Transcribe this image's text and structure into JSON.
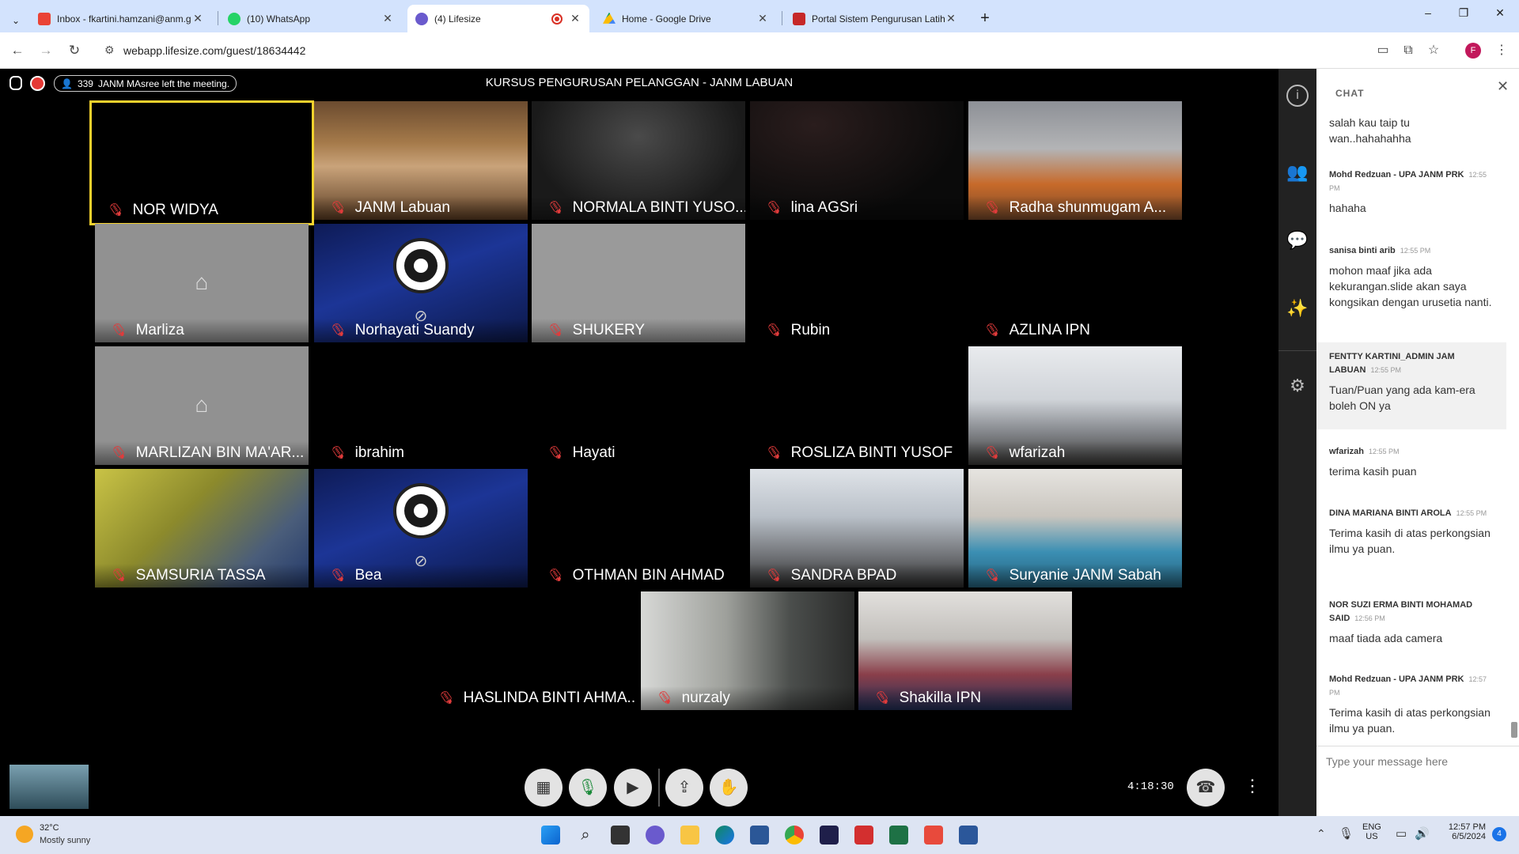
{
  "browser": {
    "tabs": [
      {
        "title": "Inbox - fkartini.hamzani@anm.g",
        "fav": "#ea4335",
        "icon": "gmail-icon"
      },
      {
        "title": "(10) WhatsApp",
        "fav": "#25d366",
        "icon": "whatsapp-icon"
      },
      {
        "title": "(4) Lifesize",
        "fav": "#6a5acd",
        "icon": "lifesize-icon"
      },
      {
        "title": "Home - Google Drive",
        "fav": "#fbbc04",
        "icon": "google-drive-icon"
      },
      {
        "title": "Portal Sistem Pengurusan Latih",
        "fav": "#c62828",
        "icon": "portal-icon"
      }
    ],
    "new_tab": "+",
    "url": "webapp.lifesize.com/guest/18634442",
    "profile_initial": "F",
    "window_controls": [
      "–",
      "❐",
      "✕"
    ]
  },
  "meeting": {
    "title": "KURSUS PENGURUSAN PELANGGAN - JANM LABUAN",
    "participant_count": "339",
    "notification": "JANM MAsree left the meeting.",
    "timer": "4:18:30",
    "participants": [
      "NOR WIDYA",
      "JANM Labuan",
      "NORMALA BINTI YUSO...",
      "lina AGSri",
      "Radha shunmugam A...",
      "Marliza",
      "Norhayati Suandy",
      "SHUKERY",
      "Rubin",
      "AZLINA IPN",
      "MARLIZAN BIN MA'AR...",
      "ibrahim",
      "Hayati",
      "ROSLIZA BINTI YUSOF",
      "wfarizah",
      "SAMSURIA TASSA",
      "Bea",
      "OTHMAN BIN AHMAD",
      "SANDRA BPAD",
      "Suryanie JANM Sabah",
      "HASLINDA BINTI AHMA...",
      "nurzaly",
      "Shakilla IPN"
    ]
  },
  "chat": {
    "heading": "CHAT",
    "messages": [
      {
        "sender": "",
        "time": "",
        "text": "salah kau taip tu wan..hahahahha"
      },
      {
        "sender": "Mohd Redzuan - UPA JANM PRK",
        "time": "12:55 PM",
        "text": "hahaha"
      },
      {
        "sender": "sanisa binti arib",
        "time": "12:55 PM",
        "text": "mohon maaf jika ada kekurangan.slide akan saya kongsikan dengan urusetia nanti."
      },
      {
        "sender": "FENTTY KARTINI_ADMIN JAM LABUAN",
        "time": "12:55 PM",
        "text": "Tuan/Puan yang ada kam-era boleh ON ya"
      },
      {
        "sender": "wfarizah",
        "time": "12:55 PM",
        "text": "terima kasih puan"
      },
      {
        "sender": "DINA MARIANA BINTI AROLA",
        "time": "12:55 PM",
        "text": "Terima kasih di atas perkongsian ilmu ya  puan."
      },
      {
        "sender": "NOR SUZI ERMA BINTI MOHAMAD SAID",
        "time": "12:56 PM",
        "text": "maaf tiada ada camera"
      },
      {
        "sender": "Mohd Redzuan - UPA JANM PRK",
        "time": "12:57 PM",
        "text": "Terima kasih di atas perkongsian ilmu ya  puan."
      }
    ],
    "input_placeholder": "Type your message here"
  },
  "taskbar": {
    "temperature": "32°C",
    "weather": "Mostly sunny",
    "lang_top": "ENG",
    "lang_bottom": "US",
    "time": "12:57 PM",
    "date": "6/5/2024",
    "notification_count": "4"
  }
}
